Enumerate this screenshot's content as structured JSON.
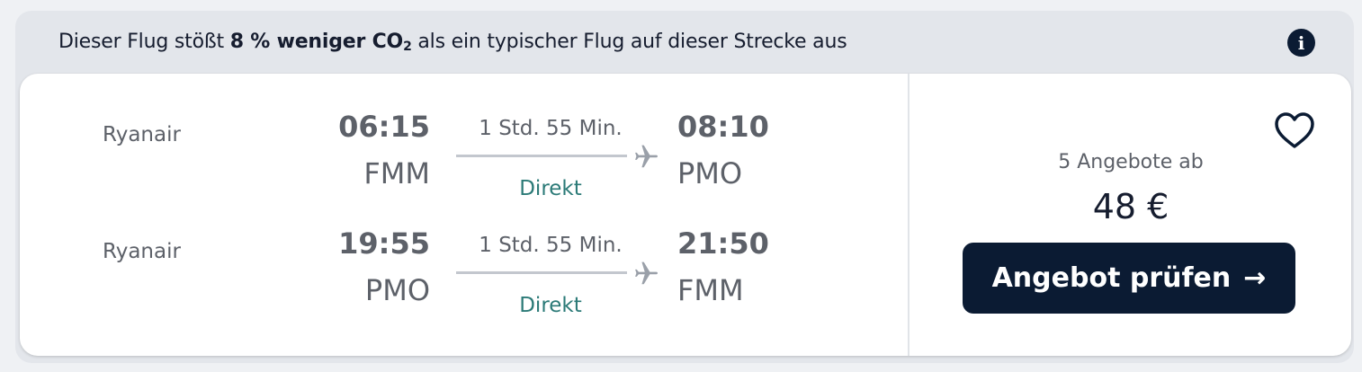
{
  "banner": {
    "prefix": "Dieser Flug stößt ",
    "highlight_percent": "8 % weniger CO",
    "highlight_sub": "2",
    "suffix": " als ein typischer Flug auf dieser Strecke aus",
    "info_icon": "info-icon"
  },
  "legs": [
    {
      "airline": "Ryanair",
      "depart_time": "06:15",
      "depart_code": "FMM",
      "duration": "1 Std. 55 Min.",
      "stops": "Direkt",
      "arrive_time": "08:10",
      "arrive_code": "PMO"
    },
    {
      "airline": "Ryanair",
      "depart_time": "19:55",
      "depart_code": "PMO",
      "duration": "1 Std. 55 Min.",
      "stops": "Direkt",
      "arrive_time": "21:50",
      "arrive_code": "FMM"
    }
  ],
  "offer": {
    "offers_label": "5 Angebote ab",
    "price": "48 €",
    "cta_label": "Angebot prüfen",
    "cta_arrow": "→",
    "favorite_icon": "heart-icon"
  },
  "colors": {
    "primary": "#0b1b33",
    "direct": "#2b7a77",
    "muted_text": "#5d6169",
    "background": "#e3e6eb"
  }
}
